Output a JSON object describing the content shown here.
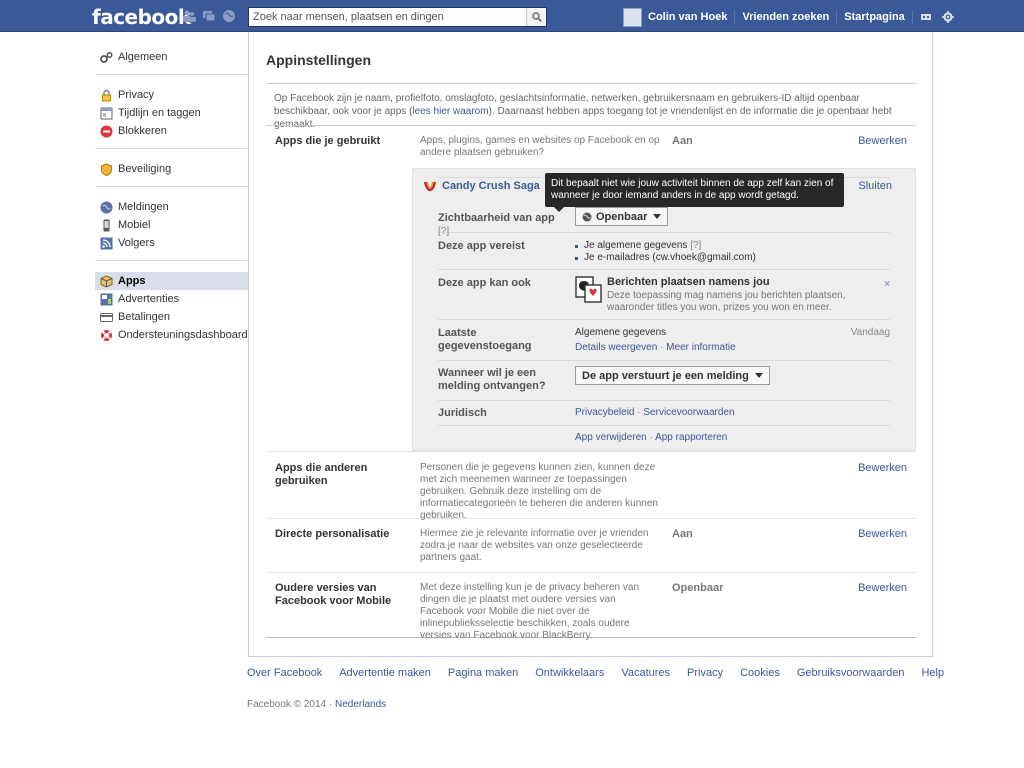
{
  "topbar": {
    "logo": "facebook",
    "search_placeholder": "Zoek naar mensen, plaatsen en dingen",
    "user_name": "Colin van Hoek",
    "find_friends": "Vrienden zoeken",
    "home": "Startpagina"
  },
  "nav": {
    "general": "Algemeen",
    "privacy": "Privacy",
    "timeline": "Tijdlijn en taggen",
    "blocking": "Blokkeren",
    "security": "Beveiliging",
    "notifications": "Meldingen",
    "mobile": "Mobiel",
    "followers": "Volgers",
    "apps": "Apps",
    "ads": "Advertenties",
    "payments": "Betalingen",
    "support": "Ondersteuningsdashboard"
  },
  "main": {
    "title": "Appinstellingen",
    "intro_before": "Op Facebook zijn je naam, profielfoto, omslagfoto, geslachtsinformatie, netwerken, gebruikersnaam en gebruikers-ID altijd openbaar beschikbaar, ook voor je apps (",
    "intro_link": "lees hier waarom",
    "intro_after": "). Daarnaast hebben apps toegang tot je vriendenlijst en de informatie die je openbaar hebt gemaakt.",
    "edit": "Bewerken",
    "rows": {
      "apps_you_use": {
        "label": "Apps die je gebruikt",
        "desc": "Apps, plugins, games en websites op Facebook en op andere plaatsen gebruiken?",
        "status": "Aan"
      },
      "apps_others_use": {
        "label": "Apps die anderen gebruiken",
        "desc": "Personen die je gegevens kunnen zien, kunnen deze met zich meenemen wanneer ze toepassingen gebruiken. Gebruik deze instelling om de informatiecategorieën te beheren die anderen kunnen gebruiken."
      },
      "instant_personalization": {
        "label": "Directe personalisatie",
        "desc": "Hiermee zie je relevante informatie over je vrienden zodra je naar de websites van onze geselecteerde partners gaat.",
        "status": "Aan"
      },
      "old_versions": {
        "label": "Oudere versies van Facebook voor Mobile",
        "desc": "Met deze instelling kun je de privacy beheren van dingen die je plaatst met oudere versies van Facebook voor Mobile die niet over de inlinepublieksselectie beschikken, zoals oudere versies van Facebook voor BlackBerry.",
        "status": "Openbaar"
      }
    }
  },
  "app": {
    "name": "Candy Crush Saga",
    "close": "Sluiten",
    "visibility_label": "Zichtbaarheid van app",
    "help": "[?]",
    "visibility_value": "Openbaar",
    "requires_label": "Deze app vereist",
    "requires_1": "Je algemene gegevens",
    "requires_2": "Je e-mailadres (cw.vhoek@gmail.com)",
    "can_label": "Deze app kan ook",
    "perm_title": "Berichten plaatsen namens jou",
    "perm_desc": "Deze toepassing mag namens jou berichten plaatsen, waaronder titles you won, prizes you won en meer.",
    "perm_x": "×",
    "last_label": "Laatste gegevenstoegang",
    "last_value": "Algemene gegevens",
    "last_date": "Vandaag",
    "details": "Details weergeven",
    "more_info": "Meer informatie",
    "notify_label": "Wanneer wil je een melding ontvangen?",
    "notify_value": "De app verstuurt je een melding",
    "legal_label": "Juridisch",
    "privacy_policy": "Privacybeleid",
    "terms": "Servicevoorwaarden",
    "remove": "App verwijderen",
    "report": "App rapporteren",
    "dot": "·"
  },
  "tooltip": "Dit bepaalt niet wie jouw activiteit binnen de app zelf kan zien of wanneer je door iemand anders in de app wordt getagd.",
  "footer": {
    "links": [
      "Over Facebook",
      "Advertentie maken",
      "Pagina maken",
      "Ontwikkelaars",
      "Vacatures",
      "Privacy",
      "Cookies",
      "Gebruiksvoorwaarden",
      "Help"
    ],
    "copyright": "Facebook © 2014 ·",
    "language": "Nederlands"
  },
  "colors": {
    "brand": "#3b5998",
    "link": "#3b5998",
    "panel_bg": "#eeeeee",
    "tooltip_bg": "#282828"
  },
  "icons": {
    "friends": "friends-icon",
    "messages": "messages-icon",
    "globe": "globe-icon",
    "search": "search-icon",
    "privacy_shortcuts": "privacy-shortcuts-icon",
    "settings": "gear-icon"
  }
}
